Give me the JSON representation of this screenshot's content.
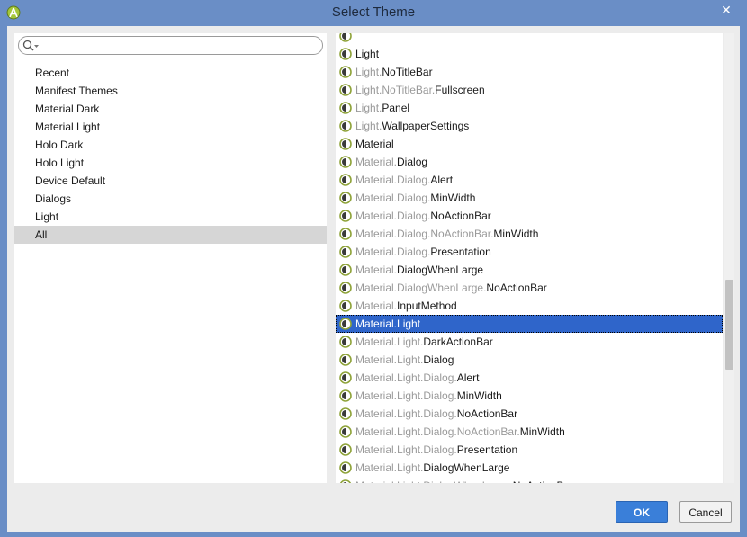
{
  "window": {
    "title": "Select Theme",
    "close_glyph": "✕",
    "app_icon": "android-studio-icon"
  },
  "search": {
    "value": "",
    "placeholder": ""
  },
  "categories": [
    {
      "label": "Recent"
    },
    {
      "label": "Manifest Themes"
    },
    {
      "label": "Material Dark"
    },
    {
      "label": "Material Light"
    },
    {
      "label": "Holo Dark"
    },
    {
      "label": "Holo Light"
    },
    {
      "label": "Device Default"
    },
    {
      "label": "Dialogs"
    },
    {
      "label": "Light"
    },
    {
      "label": "All"
    }
  ],
  "selected_category": "All",
  "themes": [
    {
      "prefix": "",
      "name": ""
    },
    {
      "prefix": "",
      "name": "Light"
    },
    {
      "prefix": "Light.",
      "name": "NoTitleBar"
    },
    {
      "prefix": "Light.NoTitleBar.",
      "name": "Fullscreen"
    },
    {
      "prefix": "Light.",
      "name": "Panel"
    },
    {
      "prefix": "Light.",
      "name": "WallpaperSettings"
    },
    {
      "prefix": "",
      "name": "Material"
    },
    {
      "prefix": "Material.",
      "name": "Dialog"
    },
    {
      "prefix": "Material.Dialog.",
      "name": "Alert"
    },
    {
      "prefix": "Material.Dialog.",
      "name": "MinWidth"
    },
    {
      "prefix": "Material.Dialog.",
      "name": "NoActionBar"
    },
    {
      "prefix": "Material.Dialog.NoActionBar.",
      "name": "MinWidth"
    },
    {
      "prefix": "Material.Dialog.",
      "name": "Presentation"
    },
    {
      "prefix": "Material.",
      "name": "DialogWhenLarge"
    },
    {
      "prefix": "Material.DialogWhenLarge.",
      "name": "NoActionBar"
    },
    {
      "prefix": "Material.",
      "name": "InputMethod"
    },
    {
      "prefix": "Material.",
      "name": "Light",
      "selected": true
    },
    {
      "prefix": "Material.Light.",
      "name": "DarkActionBar"
    },
    {
      "prefix": "Material.Light.",
      "name": "Dialog"
    },
    {
      "prefix": "Material.Light.Dialog.",
      "name": "Alert"
    },
    {
      "prefix": "Material.Light.Dialog.",
      "name": "MinWidth"
    },
    {
      "prefix": "Material.Light.Dialog.",
      "name": "NoActionBar"
    },
    {
      "prefix": "Material.Light.Dialog.NoActionBar.",
      "name": "MinWidth"
    },
    {
      "prefix": "Material.Light.Dialog.",
      "name": "Presentation"
    },
    {
      "prefix": "Material.Light.",
      "name": "DialogWhenLarge"
    },
    {
      "prefix": "Material.Light.DialogWhenLarge.",
      "name": "NoActionBar"
    }
  ],
  "buttons": {
    "ok": "OK",
    "cancel": "Cancel"
  },
  "colors": {
    "title_bar": "#6a8ec6",
    "selection": "#2f65ca",
    "ok_button": "#3a7fd9",
    "theme_icon_ring": "#8fa33a"
  }
}
